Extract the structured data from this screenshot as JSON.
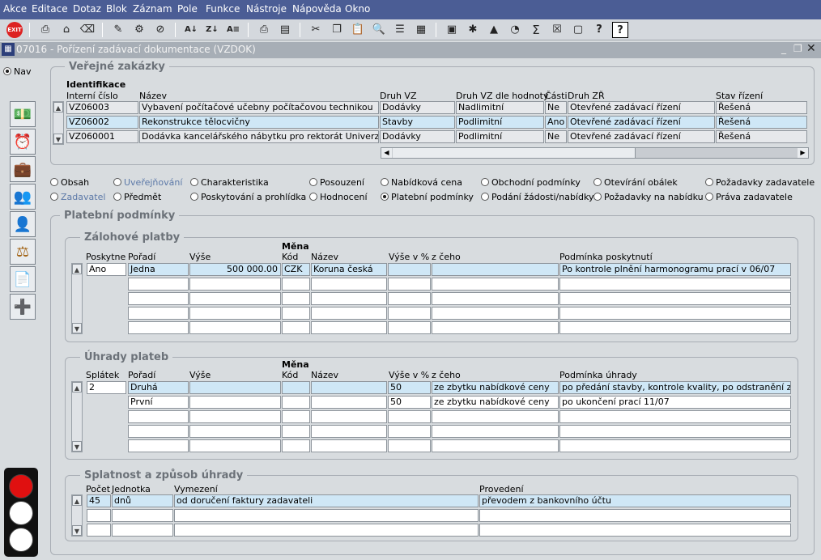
{
  "menu": [
    "Akce",
    "Editace",
    "Dotaz",
    "Blok",
    "Záznam",
    "Pole",
    "Funkce",
    "Nástroje",
    "Nápověda",
    "Okno"
  ],
  "window": {
    "title": "07016 - Pořízení zadávací dokumentace (VZDOK)"
  },
  "nav_label": "Nav",
  "verejne": {
    "legend": "Veřejné zakázky",
    "group": "Identifikace",
    "headers": {
      "interni": "Interní číslo",
      "nazev": "Název",
      "druh": "Druh VZ",
      "druh_hod": "Druh VZ dle hodnoty",
      "casti": "Části",
      "druh_zr": "Druh ZŘ",
      "stav": "Stav řízení"
    },
    "rows": [
      {
        "interni": "VZ06003",
        "nazev": "Vybavení počítačové učebny počítačovou technikou",
        "druh": "Dodávky",
        "druh_hod": "Nadlimitní",
        "casti": "Ne",
        "druh_zr": "Otevřené zadávací řízení",
        "stav": "Řešená"
      },
      {
        "interni": "VZ06002",
        "nazev": "Rekonstrukce tělocvičny",
        "druh": "Stavby",
        "druh_hod": "Podlimitní",
        "casti": "Ano",
        "druh_zr": "Otevřené zadávací řízení",
        "stav": "Řešená"
      },
      {
        "interni": "VZ060001",
        "nazev": "Dodávka kancelářského nábytku pro rektorát Univerzity",
        "druh": "Dodávky",
        "druh_hod": "Podlimitní",
        "casti": "Ne",
        "druh_zr": "Otevřené zadávací řízení",
        "stav": "Řešená"
      }
    ]
  },
  "tabs": {
    "obsah": "Obsah",
    "uverejnovani": "Uveřejňování",
    "zadavatel": "Zadavatel",
    "predmet": "Předmět",
    "charakteristika": "Charakteristika",
    "poskytovani": "Poskytování a prohlídka",
    "posouzeni": "Posouzení",
    "hodnoceni": "Hodnocení",
    "nabidkova_cena": "Nabídková cena",
    "platebni": "Platební podmínky",
    "obchodni": "Obchodní podmínky",
    "podani": "Podání žádosti/nabídky",
    "otevirani": "Otevírání obálek",
    "pozadavky_nabidka": "Požadavky na nabídku",
    "pozadavky_zadavatele": "Požadavky zadavatele",
    "prava": "Práva zadavatele"
  },
  "platebni": {
    "legend": "Platební podmínky",
    "zalohove": {
      "legend": "Zálohové platby",
      "mena": "Měna",
      "headers": {
        "poskytne": "Poskytne",
        "poradi": "Pořadí",
        "vyse": "Výše",
        "kod": "Kód",
        "nazev": "Název",
        "vyse_pct": "Výše v %",
        "z_ceho": "z čeho",
        "podminka": "Podmínka poskytnutí"
      },
      "poskytne": "Ano",
      "rows": [
        {
          "poradi": "Jedna",
          "vyse": "500 000.00",
          "kod": "CZK",
          "nazev": "Koruna česká",
          "vyse_pct": "",
          "z_ceho": "",
          "podminka": "Po kontrole plnění harmonogramu prací v 06/07"
        }
      ]
    },
    "uhrady": {
      "legend": "Úhrady plateb",
      "mena": "Měna",
      "headers": {
        "splatek": "Splátek",
        "poradi": "Pořadí",
        "vyse": "Výše",
        "kod": "Kód",
        "nazev": "Název",
        "vyse_pct": "Výše v %",
        "z_ceho": "z čeho",
        "podminka": "Podmínka úhrady"
      },
      "splatek": "2",
      "rows": [
        {
          "poradi": "Druhá",
          "vyse": "",
          "kod": "",
          "nazev": "",
          "vyse_pct": "50",
          "z_ceho": "ze zbytku nabídkové ceny",
          "podminka": "po předání stavby,  kontrole kvality, po odstranění závad"
        },
        {
          "poradi": "První",
          "vyse": "",
          "kod": "",
          "nazev": "",
          "vyse_pct": "50",
          "z_ceho": "ze zbytku nabídkové ceny",
          "podminka": "po ukončení prací 11/07"
        }
      ]
    },
    "splatnost": {
      "legend": "Splatnost a způsob úhrady",
      "headers": {
        "pocet": "Počet",
        "jednotka": "Jednotka",
        "vymezeni": "Vymezení",
        "provedeni": "Provedení"
      },
      "rows": [
        {
          "pocet": "45",
          "jednotka": "dnů",
          "vymezeni": "od doručení faktury zadavateli",
          "provedeni": "převodem z bankovního účtu"
        }
      ]
    }
  }
}
